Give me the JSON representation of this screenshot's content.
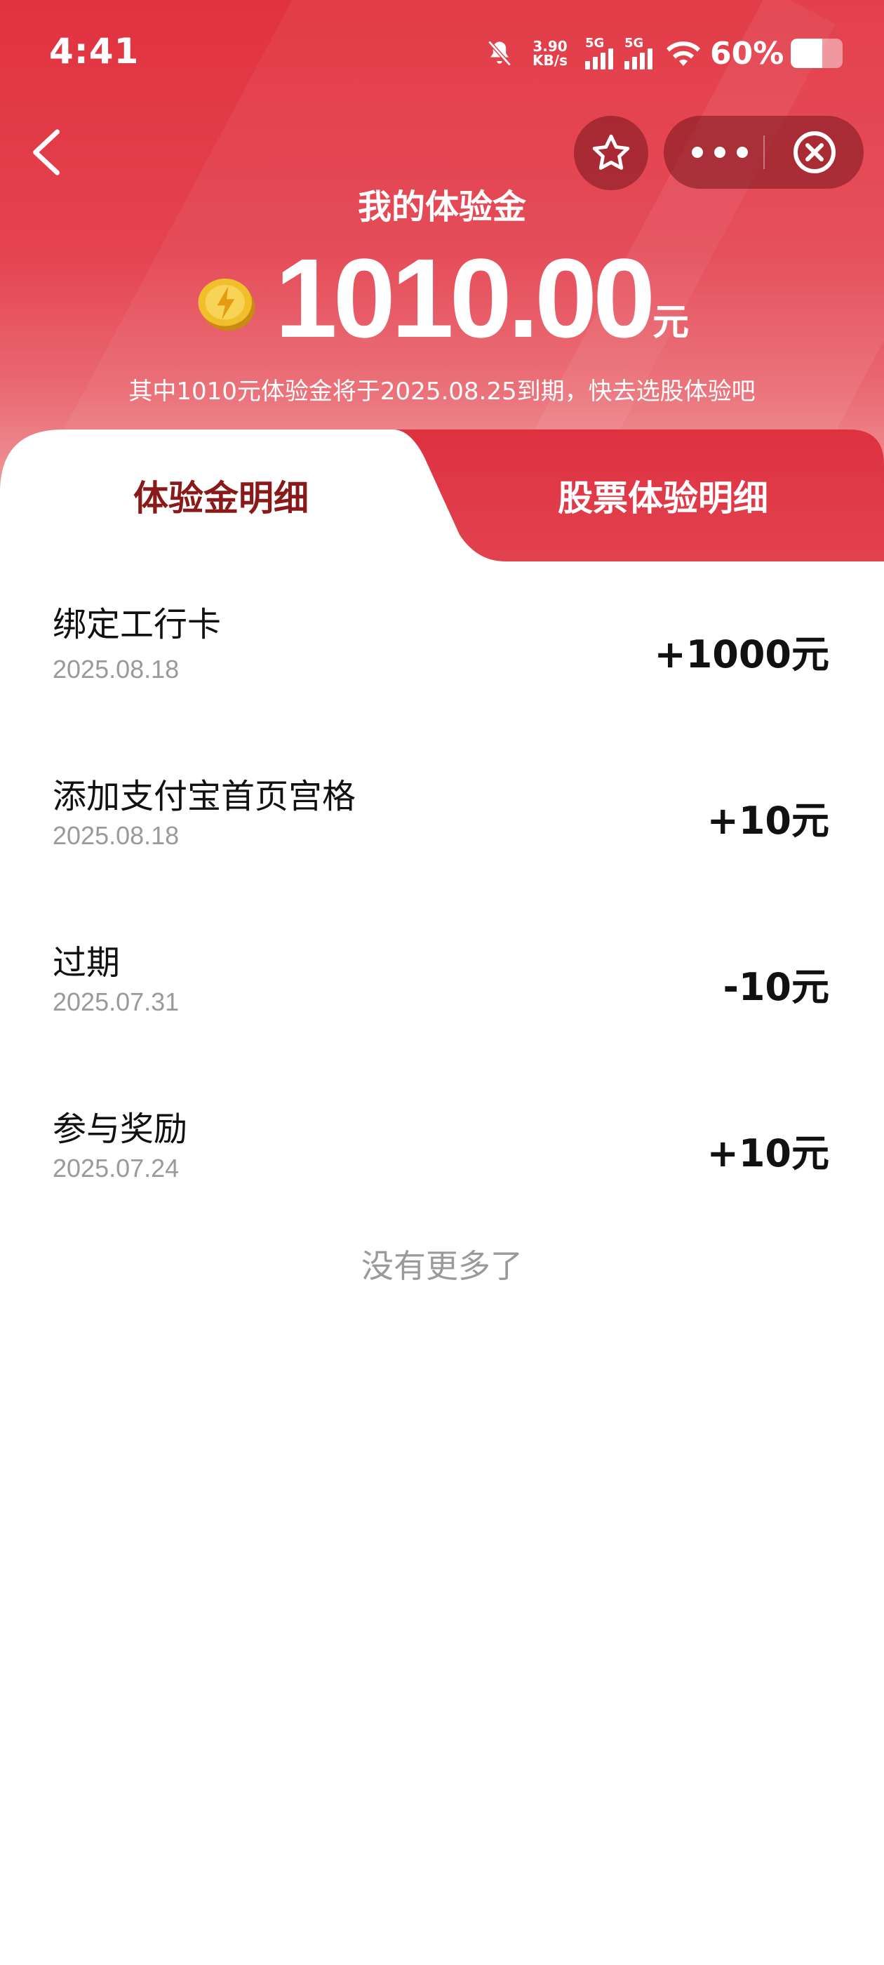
{
  "status_bar": {
    "time": "4:41",
    "speed_value": "3.90",
    "speed_unit": "KB/s",
    "signal_label_1": "5G",
    "signal_label_2": "5G",
    "battery_percent": "60%",
    "battery_level": 0.6
  },
  "header": {
    "title": "我的体验金",
    "amount": "1010.00",
    "unit": "元",
    "notice": "其中1010元体验金将于2025.08.25到期，快去选股体验吧"
  },
  "tabs": [
    {
      "label": "体验金明细",
      "active": true
    },
    {
      "label": "股票体验明细",
      "active": false
    }
  ],
  "records": [
    {
      "title": "绑定工行卡",
      "date": "2025.08.18",
      "amount": "+1000元"
    },
    {
      "title": "添加支付宝首页宫格",
      "date": "2025.08.18",
      "amount": "+10元"
    },
    {
      "title": "过期",
      "date": "2025.07.31",
      "amount": "-10元"
    },
    {
      "title": "参与奖励",
      "date": "2025.07.24",
      "amount": "+10元"
    }
  ],
  "footer_text": "没有更多了",
  "colors": {
    "brand_red": "#e1323f",
    "active_tab_text": "#8a1a1a"
  }
}
